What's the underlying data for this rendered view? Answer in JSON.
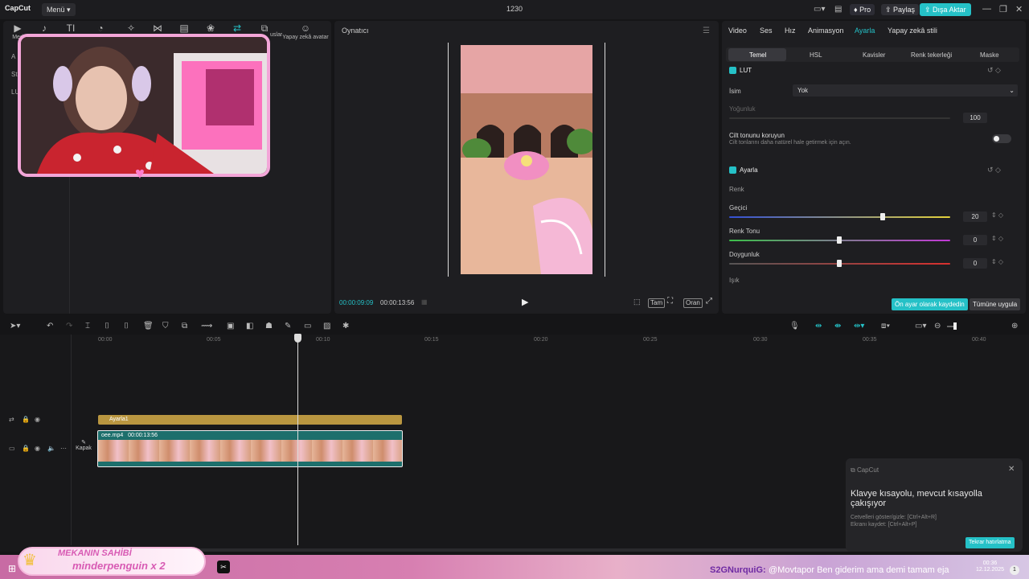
{
  "titlebar": {
    "logo": "CapCut",
    "menu": "Menü",
    "project": "1230",
    "pro": "Pro",
    "share": "Paylaş",
    "export": "Dışa Aktar"
  },
  "media_panel": {
    "tools": [
      "Med",
      "",
      "TI",
      "",
      "",
      "",
      "",
      "",
      "",
      "",
      "uslar",
      ""
    ],
    "ai_avatar": "Yapay zekâ avatar",
    "side_fragments": [
      "A",
      "St",
      "LU"
    ]
  },
  "player": {
    "title": "Oynatıcı",
    "current_time": "00:00:09:09",
    "total_time": "00:00:13:56",
    "buttons": [
      "Tam",
      "Oran"
    ]
  },
  "inspector": {
    "tabs": [
      "Video",
      "Ses",
      "Hız",
      "Animasyon",
      "Ayarla",
      "Yapay zekâ stili"
    ],
    "active_tab": "Ayarla",
    "subtabs": [
      "Temel",
      "HSL",
      "Kavisler",
      "Renk tekerleği",
      "Maske"
    ],
    "lut_label": "LUT",
    "name_label": "İsim",
    "name_value": "Yok",
    "intensity_label": "Yoğunluk",
    "intensity_value": "100",
    "skin_title": "Cilt tonunu koruyun",
    "skin_desc": "Cilt tonlarını daha natürel hale getirmek için açın.",
    "adjust_label": "Ayarla",
    "color_section": "Renk",
    "temp_label": "Geçici",
    "temp_value": "20",
    "hue_label": "Renk Tonu",
    "hue_value": "0",
    "sat_label": "Doygunluk",
    "sat_value": "0",
    "light_section": "Işık",
    "save_preset": "Ön ayar olarak kaydedin",
    "apply_all": "Tümüne uygula"
  },
  "timeline": {
    "ruler": [
      "00:00",
      "00:05",
      "00:10",
      "00:15",
      "00:20",
      "00:25",
      "00:30",
      "00:35",
      "00:40"
    ],
    "adjust_clip": "Ayarla1",
    "video_clip_name": "oee.mp4",
    "video_clip_duration": "00:00:13:56",
    "cover_label": "Kapak"
  },
  "notification": {
    "app": "CapCut",
    "title": "Klavye kısayolu, mevcut kısayolla çakışıyor",
    "line1": "Cetvelleri göster/gizle: [Ctrl+Alt+R]",
    "line2": "Ekranı kaydet: [Ctrl+Alt+P]",
    "button": "Tekrar hatırlatma"
  },
  "stream_overlay": {
    "banner_line1": "MEKANIN SAHİBİ",
    "banner_line2": "minderpenguin x 2",
    "chat_user": "S2GNurquiG:",
    "chat_message": "@Movtapor Ben giderim ama demi tamam eja",
    "clock_time": "00:36",
    "clock_date": "12.12.2025"
  }
}
